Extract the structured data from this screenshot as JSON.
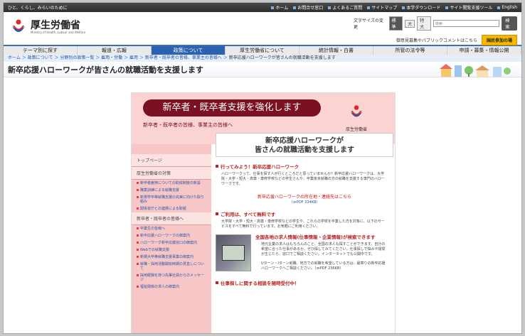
{
  "topbar": {
    "tagline": "ひと、くらし、みらいのために",
    "links": [
      "ホーム",
      "お問合せ窓口",
      "よくあるご質問",
      "サイトマップ",
      "本学ダウンロード",
      "サイト閲覧支援ツール",
      "English"
    ]
  },
  "logo": {
    "title": "厚生労働省",
    "subtitle": "Ministry of Health, Labour and Welfare"
  },
  "fontsize": {
    "label": "文字サイズの変更",
    "sizes": [
      "標準",
      "大",
      "特大"
    ]
  },
  "search": {
    "placeholder": "検索",
    "button": "検索"
  },
  "header_links": {
    "opinion": "御意見募集やパブリックコメントはこちら",
    "join": "国民参加の場"
  },
  "gnav": [
    "テーマ別に探す",
    "報道・広報",
    "政策について",
    "厚生労働省について",
    "統計情報・白書",
    "所管の法令等",
    "申請・募集・情報公開"
  ],
  "breadcrumb": [
    "ホーム",
    "政策について",
    "分野別の政策一覧",
    "雇用・労働",
    "雇用",
    "新卒者・既卒者の皆様、事業主の皆様へ"
  ],
  "breadcrumb_current": "新卒応援ハローワークが皆さんの就職活動を支援します",
  "page_title": "新卒応援ハローワークが皆さんの就職活動を支援します",
  "hero": {
    "banner": "新卒者・既卒者支援を強化します",
    "subtitle": "新卒者・既卒者の皆様、事業主の皆様へ",
    "ministry": "厚生労働省"
  },
  "side": {
    "top": "トップページ",
    "measures_head": "厚生労働省の対策",
    "measures": [
      "新卒者雇用についての助成制度の新設",
      "職業訓練による就職支援",
      "新規学卒等就職支援の充実に向けた取り組み",
      "関係省庁との連携による取組"
    ],
    "grads_head": "新卒者・既卒者の皆様へ",
    "grads": [
      "卒業生の皆様へ",
      "新卒応援ハローワークの御案内",
      "ハローワーク新卒応援窓口の御案内",
      "Webでの就職支援",
      "新規大卒等就職支援事業の御案内",
      "就職・採用活動開始時期の見直しについて",
      "採用経験を持つ先輩社員からのメッセージ",
      "福祉関係の求人の御案内"
    ]
  },
  "main": {
    "title_line1": "新卒応援ハローワークが",
    "title_line2": "皆さんの就職活動を支援します",
    "s1": "行ってみよう！新卒応援ハローワーク",
    "s1_text": "ハローワークって、仕事を探す人が行くところだと思っていませんか？新卒応援ハローワークは、大学院・大学・短大・高専・専修学校などの学生さんや、卒業後未就職の方の就職を支援する専門のハローワークです。",
    "s1_link": "新卒応援ハローワークの所在地・連絡先はこちら",
    "s1_pdf": "（≫PDF 334KB）",
    "s2": "ご利用は、すべて無料です",
    "s2_text": "大学院・大学・短大・高専・専修学校などの学生や、これらの学校を卒業した方を対象に、以下のサービスをすべて無料で行っています。お気軽にご利用ください。",
    "s3": "全国各地の求人情報(仕事情報・企業情報)が検索できます",
    "s3_text": "地元企業の求人はもちろんのこと、全国の求人も探すことができます。自分の希望に合った仕事があるか、ぜひ探してみてください。仕事探しで悩みや疑問が生じたら、窓口でご相談ください。インターネットでも公開中です。",
    "s3_text2": "Uターン・Iターン就職、地方での就職を希望している方は、最寄りの新卒応援ハローワークへご相談ください。（≫PDF 236KB）",
    "s4": "仕事探しに関する相談を随時受付中！"
  }
}
